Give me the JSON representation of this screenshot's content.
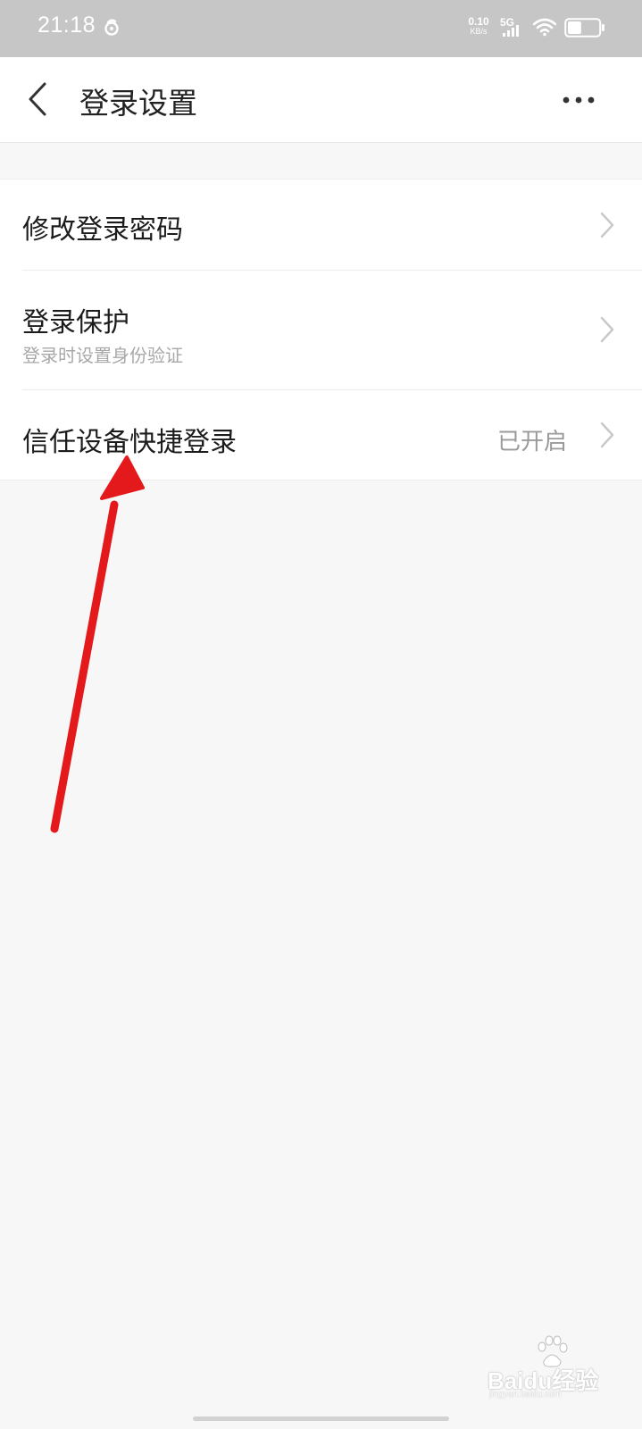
{
  "status_bar": {
    "time": "21:18",
    "speed_value": "0.10",
    "speed_unit": "KB/s",
    "network": "5G",
    "battery_level": 0.45
  },
  "header": {
    "title": "登录设置",
    "back_icon": "chevron-left-icon",
    "more_icon": "more-dots-icon"
  },
  "settings": {
    "items": [
      {
        "title": "修改登录密码",
        "subtitle": "",
        "value": ""
      },
      {
        "title": "登录保护",
        "subtitle": "登录时设置身份验证",
        "value": ""
      },
      {
        "title": "信任设备快捷登录",
        "subtitle": "",
        "value": "已开启"
      }
    ]
  },
  "watermark": {
    "brand": "Baidu经验",
    "url": "jingyan.baidu.com"
  },
  "colors": {
    "status_bar_bg": "#c6c6c6",
    "page_bg": "#f7f7f7",
    "annotation_arrow": "#e3191c",
    "chevron": "#c8c8c8"
  }
}
